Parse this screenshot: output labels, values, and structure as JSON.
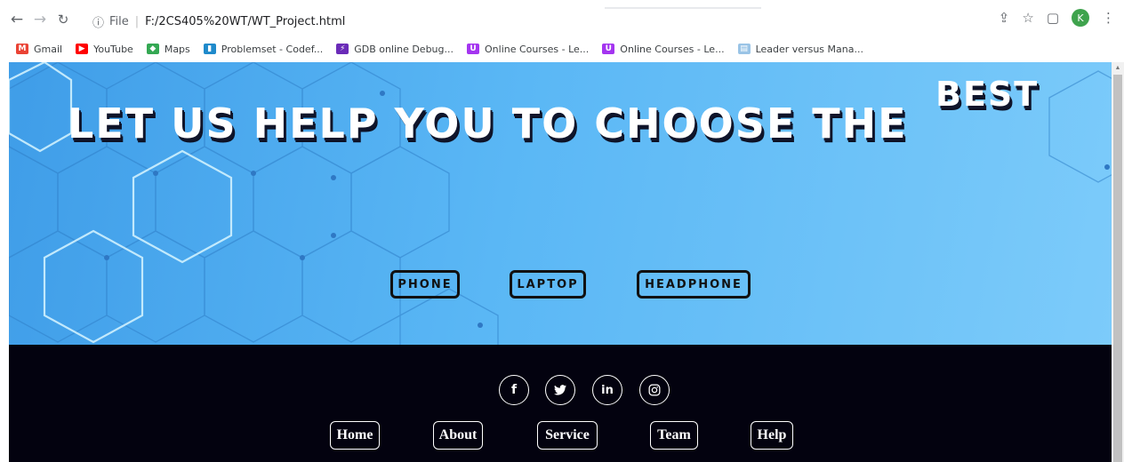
{
  "browser": {
    "url_prefix": "File",
    "url": "F:/2CS405%20WT/WT_Project.html",
    "profile_initial": "K",
    "bookmarks": [
      {
        "label": "Gmail",
        "icon": "gmail-icon",
        "color": "#ea4335",
        "glyph": "M"
      },
      {
        "label": "YouTube",
        "icon": "youtube-icon",
        "color": "#ff0000",
        "glyph": "▶"
      },
      {
        "label": "Maps",
        "icon": "maps-icon",
        "color": "#34a853",
        "glyph": "◆"
      },
      {
        "label": "Problemset - Codef...",
        "icon": "codeforces-icon",
        "color": "#1f8acb",
        "glyph": "▮"
      },
      {
        "label": "GDB online Debug...",
        "icon": "gdb-icon",
        "color": "#6a2bb8",
        "glyph": "⚡"
      },
      {
        "label": "Online Courses - Le...",
        "icon": "udemy-icon",
        "color": "#a435f0",
        "glyph": "U"
      },
      {
        "label": "Online Courses - Le...",
        "icon": "udemy-icon",
        "color": "#a435f0",
        "glyph": "U"
      },
      {
        "label": "Leader versus Mana...",
        "icon": "page-icon",
        "color": "#9ac4e6",
        "glyph": "▤"
      }
    ]
  },
  "hero": {
    "headline": "LET US HELP YOU TO CHOOSE THE",
    "headline_emphasis": "BEST",
    "buttons": [
      "PHONE",
      "LAPTOP",
      "HEADPHONE"
    ],
    "colors": {
      "sky": "#5ab7f5",
      "text_shadow": "#10152b"
    }
  },
  "footer": {
    "social": [
      {
        "icon": "facebook-icon",
        "glyph": "f"
      },
      {
        "icon": "twitter-icon",
        "glyph": "🐦"
      },
      {
        "icon": "linkedin-icon",
        "glyph": "in"
      },
      {
        "icon": "instagram-icon",
        "glyph": "◎"
      }
    ],
    "nav": [
      "Home",
      "About",
      "Service",
      "Team",
      "Help"
    ],
    "background": "#03020f"
  }
}
